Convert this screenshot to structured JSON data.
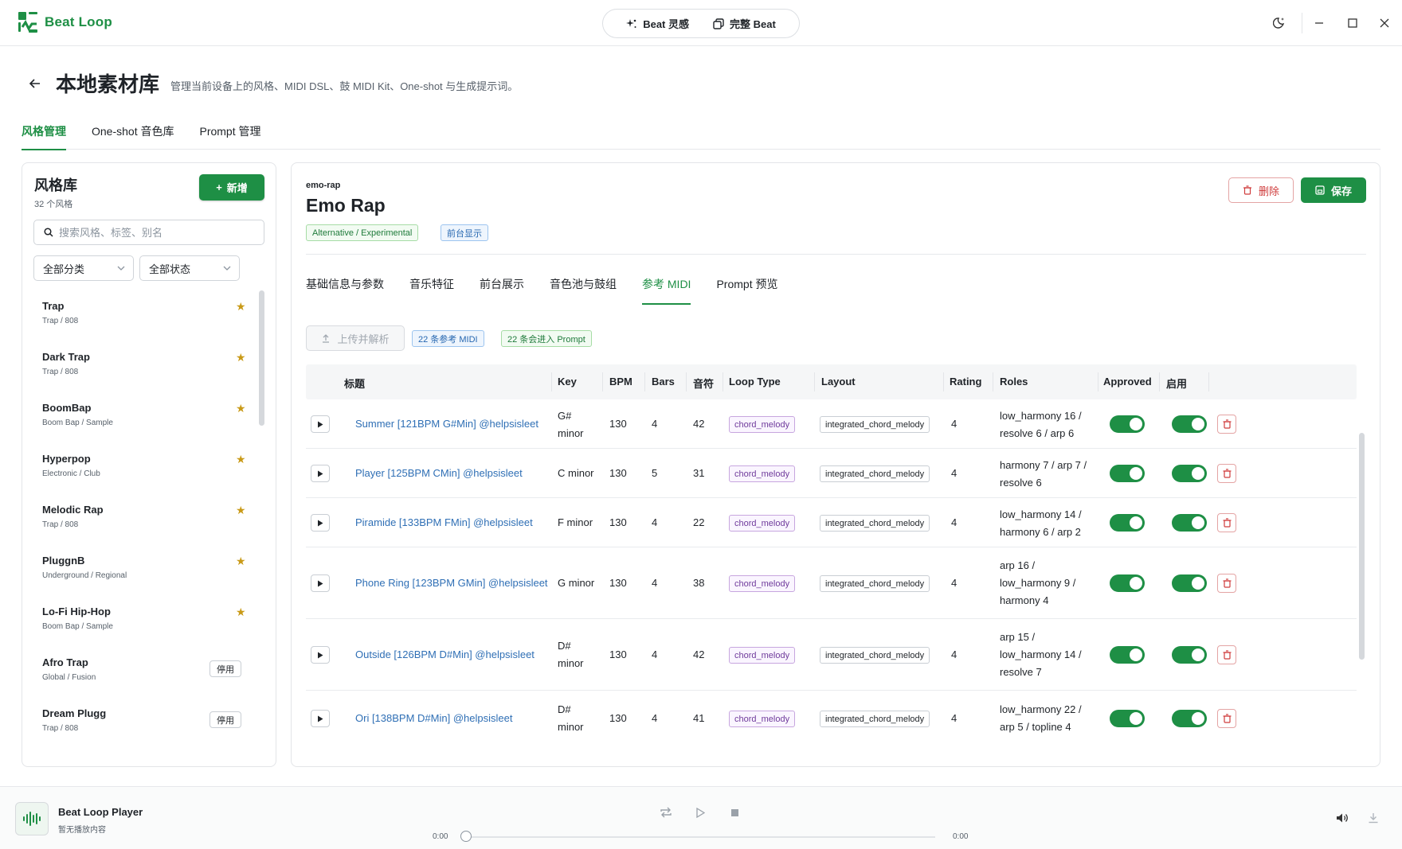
{
  "app": {
    "name": "Beat Loop"
  },
  "mode_switch": {
    "inspiration": "Beat 灵感",
    "full": "完整 Beat"
  },
  "header": {
    "title": "本地素材库",
    "description": "管理当前设备上的风格、MIDI DSL、鼓 MIDI Kit、One-shot 与生成提示词。"
  },
  "main_tabs": [
    "风格管理",
    "One-shot 音色库",
    "Prompt 管理"
  ],
  "library": {
    "title": "风格库",
    "count": "32 个风格",
    "add_label": "新增",
    "search_placeholder": "搜索风格、标签、别名",
    "filter_category": "全部分类",
    "filter_status": "全部状态",
    "items": [
      {
        "name": "Trap",
        "category": "Trap / 808",
        "status": "star"
      },
      {
        "name": "Dark Trap",
        "category": "Trap / 808",
        "status": "star"
      },
      {
        "name": "BoomBap",
        "category": "Boom Bap / Sample",
        "status": "star"
      },
      {
        "name": "Hyperpop",
        "category": "Electronic / Club",
        "status": "star"
      },
      {
        "name": "Melodic Rap",
        "category": "Trap / 808",
        "status": "star"
      },
      {
        "name": "PluggnB",
        "category": "Underground / Regional",
        "status": "star"
      },
      {
        "name": "Lo-Fi Hip-Hop",
        "category": "Boom Bap / Sample",
        "status": "star"
      },
      {
        "name": "Afro Trap",
        "category": "Global / Fusion",
        "status": "停用"
      },
      {
        "name": "Dream Plugg",
        "category": "Trap / 808",
        "status": "停用"
      }
    ]
  },
  "detail": {
    "slug": "emo-rap",
    "title": "Emo Rap",
    "tag_category": "Alternative / Experimental",
    "tag_visibility": "前台显示",
    "delete_label": "删除",
    "save_label": "保存",
    "tabs": [
      "基础信息与参数",
      "音乐特征",
      "前台展示",
      "音色池与鼓组",
      "参考 MIDI",
      "Prompt 预览"
    ],
    "active_tab": "参考 MIDI",
    "upload_label": "上传并解析",
    "midi_count": "22 条参考 MIDI",
    "prompt_count": "22 条会进入 Prompt"
  },
  "midi_table": {
    "columns": [
      "标题",
      "Key",
      "BPM",
      "Bars",
      "音符",
      "Loop Type",
      "Layout",
      "Rating",
      "Roles",
      "Approved",
      "启用"
    ],
    "rows": [
      {
        "title": "Summer [121BPM G#Min] @helpsisleet",
        "key": "G# minor",
        "bpm": "130",
        "bars": "4",
        "notes": "42",
        "loop_type": "chord_melody",
        "layout": "integrated_chord_melody",
        "rating": "4",
        "roles": "low_harmony 16 / resolve 6 / arp 6",
        "approved": true,
        "enabled": true
      },
      {
        "title": "Player [125BPM CMin] @helpsisleet",
        "key": "C minor",
        "bpm": "130",
        "bars": "5",
        "notes": "31",
        "loop_type": "chord_melody",
        "layout": "integrated_chord_melody",
        "rating": "4",
        "roles": "harmony 7 / arp 7 / resolve 6",
        "approved": true,
        "enabled": true
      },
      {
        "title": "Piramide [133BPM FMin] @helpsisleet",
        "key": "F minor",
        "bpm": "130",
        "bars": "4",
        "notes": "22",
        "loop_type": "chord_melody",
        "layout": "integrated_chord_melody",
        "rating": "4",
        "roles": "low_harmony 14 / harmony 6 / arp 2",
        "approved": true,
        "enabled": true
      },
      {
        "title": "Phone Ring [123BPM GMin] @helpsisleet",
        "key": "G minor",
        "bpm": "130",
        "bars": "4",
        "notes": "38",
        "loop_type": "chord_melody",
        "layout": "integrated_chord_melody",
        "rating": "4",
        "roles": "arp 16 / low_harmony 9 / harmony 4",
        "approved": true,
        "enabled": true
      },
      {
        "title": "Outside [126BPM D#Min] @helpsisleet",
        "key": "D# minor",
        "bpm": "130",
        "bars": "4",
        "notes": "42",
        "loop_type": "chord_melody",
        "layout": "integrated_chord_melody",
        "rating": "4",
        "roles": "arp 15 / low_harmony 14 / resolve 7",
        "approved": true,
        "enabled": true
      },
      {
        "title": "Ori [138BPM D#Min] @helpsisleet",
        "key": "D# minor",
        "bpm": "130",
        "bars": "4",
        "notes": "41",
        "loop_type": "chord_melody",
        "layout": "integrated_chord_melody",
        "rating": "4",
        "roles": "low_harmony 22 / arp 5 / topline 4",
        "approved": true,
        "enabled": true
      }
    ]
  },
  "player": {
    "title": "Beat Loop Player",
    "subtitle": "暂无播放内容",
    "time_current": "0:00",
    "time_total": "0:00",
    "progress": 0
  },
  "colors": {
    "accent": "#1e8f45",
    "link": "#2f6fb5",
    "danger": "#cf3b3b",
    "star": "#c99a17"
  }
}
